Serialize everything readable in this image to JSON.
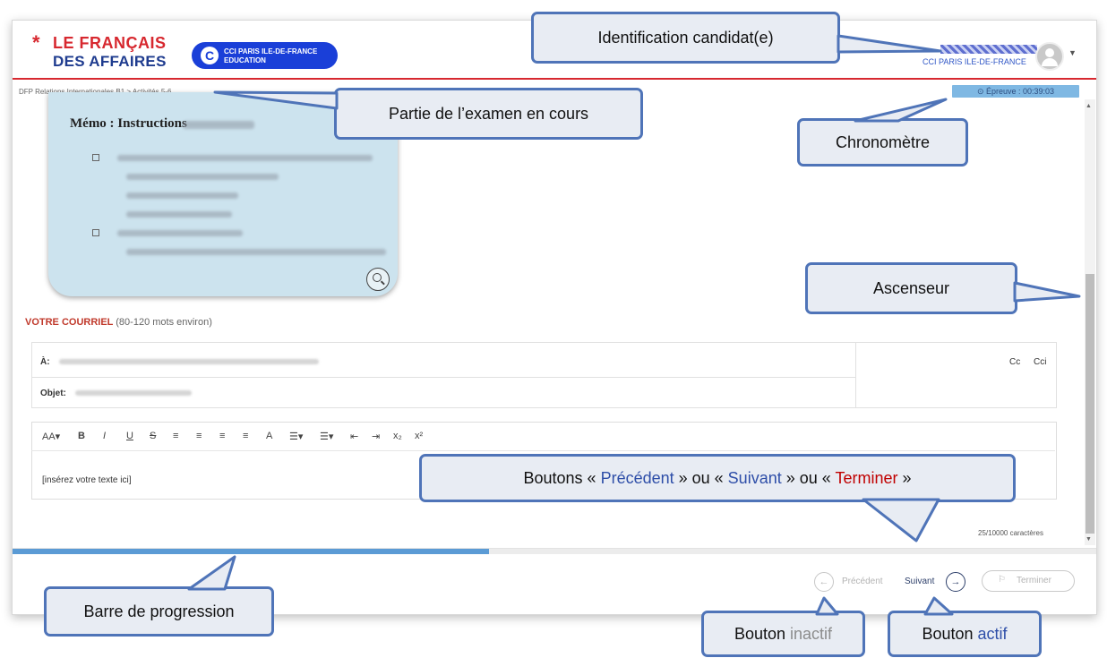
{
  "header": {
    "logo_line1": "LE FRANÇAIS",
    "logo_line2": "DES AFFAIRES",
    "logo_star": "*",
    "cci_badge_line1": "CCI PARIS ILE-DE-FRANCE",
    "cci_badge_line2": "EDUCATION",
    "org_label": "CCI PARIS ILE-DE-FRANCE"
  },
  "breadcrumb": "DFP Relations Internationales B1 > Activités 5-6",
  "timer": "⊙ Épreuve : 00:39:03",
  "memo": {
    "title": "Mémo : Instructions"
  },
  "mail": {
    "section_label": "VOTRE COURRIEL",
    "section_hint": "(80-120 mots environ)",
    "to_label": "À:",
    "subject_label": "Objet:",
    "cc": "Cc",
    "cci": "Cci"
  },
  "editor": {
    "toolbar": [
      "AA▾",
      "B",
      "I",
      "U",
      "S",
      "≡",
      "≡",
      "≡",
      "≡",
      "A",
      "☰▾",
      "☰▾",
      "⇤",
      "⇥",
      "x₂",
      "x²"
    ],
    "placeholder_text": "[insérez votre texte ici]",
    "char_count": "25/10000 caractères"
  },
  "progress": {
    "fraction": 0.44
  },
  "nav": {
    "prev_label": "Précédent",
    "next_label": "Suivant",
    "end_label": "Terminer",
    "prev_enabled": false,
    "next_enabled": true,
    "end_enabled": false
  },
  "callouts": {
    "identification": "Identification candidat(e)",
    "exam_part": "Partie de l’examen en cours",
    "chrono": "Chronomètre",
    "ascenseur": "Ascenseur",
    "buttons_prefix": "Boutons « ",
    "buttons_prev": "Précédent",
    "buttons_mid1": " » ou « ",
    "buttons_next": "Suivant",
    "buttons_mid2": " » ou « ",
    "buttons_end": "Terminer",
    "buttons_suffix": " »",
    "progress_bar": "Barre de progression",
    "inactive_prefix": "Bouton ",
    "inactive_word": "inactif",
    "active_prefix": "Bouton ",
    "active_word": "actif"
  },
  "colors": {
    "brand_red": "#d7282f",
    "brand_blue": "#1f3c8f",
    "callout_border": "#4f74b8",
    "progress": "#5b9bd5"
  }
}
